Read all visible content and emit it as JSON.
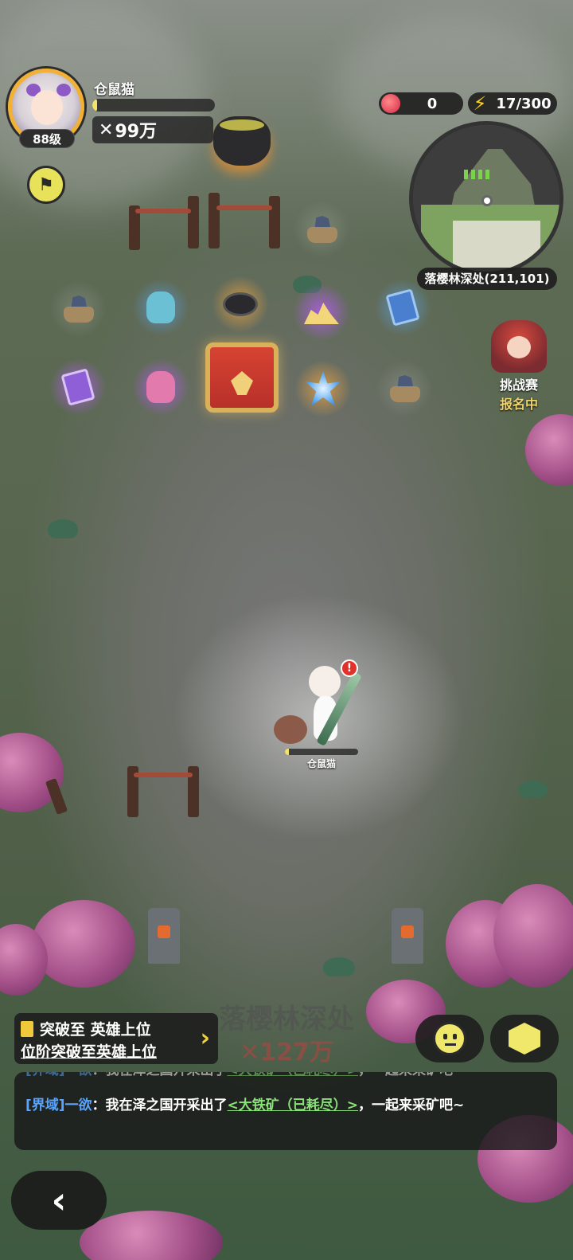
{
  "player": {
    "name": "仓鼠猫",
    "level": "88级",
    "exp_fraction": 0.04,
    "power": "99万",
    "map_tag": "仓鼠猫",
    "hp_fraction": 0.05
  },
  "resources": {
    "apple_count": "0",
    "energy": "17/300"
  },
  "minimap": {
    "location": "落樱林深处(211,101)"
  },
  "challenge": {
    "title": "挑战赛",
    "status": "报名中"
  },
  "loot": [
    {
      "kind": "ore-icon",
      "glow": "none"
    },
    {
      "kind": "ore-icon",
      "glow": "none"
    },
    {
      "kind": "blue-bag-icon",
      "glow": "blue"
    },
    {
      "kind": "medal-icon",
      "glow": "gold"
    },
    {
      "kind": "gold-pile-icon",
      "glow": "purple"
    },
    {
      "kind": "blue-scroll-icon",
      "glow": "blue"
    },
    {
      "kind": "purple-scroll-icon",
      "glow": "purple"
    },
    {
      "kind": "pink-bag-icon",
      "glow": "purple"
    },
    {
      "kind": "treasure-chest-icon",
      "glow": "gold"
    },
    {
      "kind": "crystal-icon",
      "glow": "gold"
    },
    {
      "kind": "ore-icon",
      "glow": "none"
    }
  ],
  "zone": {
    "title": "落樱林深处",
    "power": "127万"
  },
  "quest": {
    "line1": "突破至 英雄上位",
    "line2": "位阶突破至英雄上位"
  },
  "chat": [
    {
      "channel": "[界域]一欲",
      "text_before": "：我在泽之国开采出了",
      "link": "<大铁矿（已耗尽）>",
      "text_after": "，一起来采矿吧~"
    },
    {
      "channel": "[界域]一欲",
      "text_before": "：我在泽之国开采出了",
      "link": "<大铁矿（已耗尽）>",
      "text_after": "，一起来采矿吧~"
    }
  ],
  "colors": {
    "accent_yellow": "#f0e86a",
    "chat_channel": "#58a4ff",
    "chat_link": "#8be07a",
    "challenge_status": "#f0d46a"
  }
}
